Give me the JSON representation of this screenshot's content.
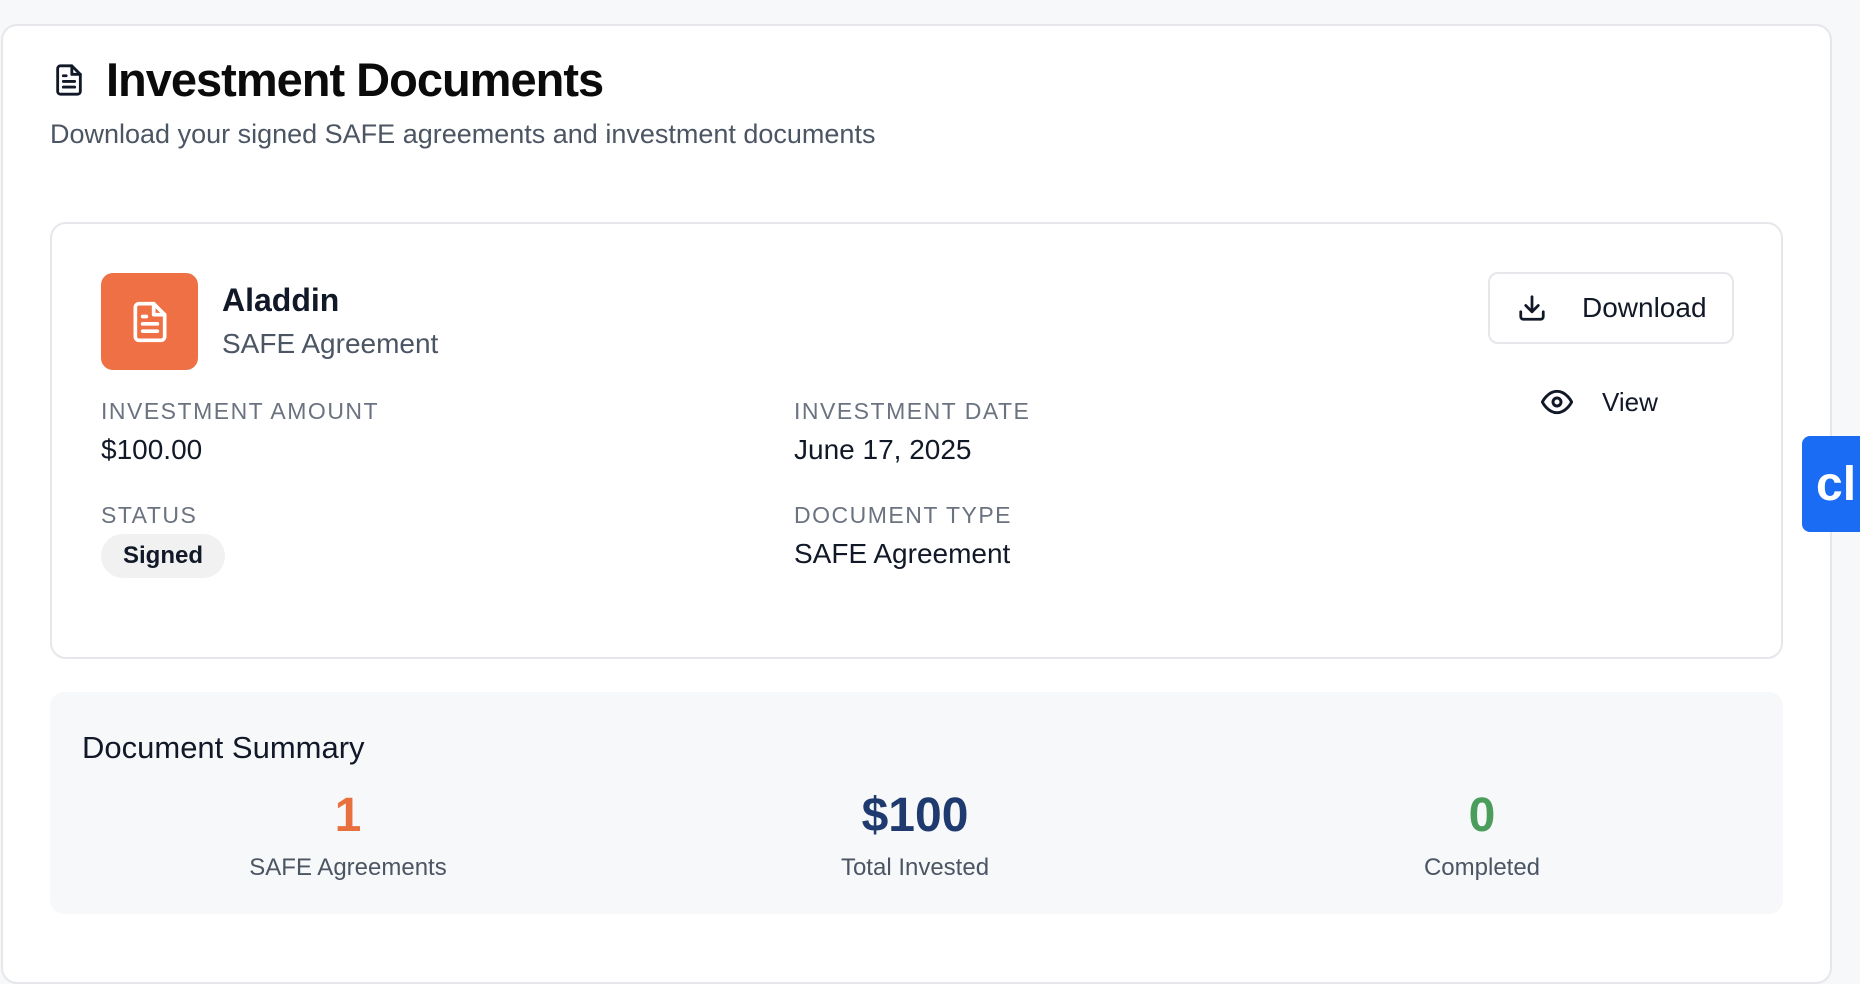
{
  "header": {
    "title": "Investment Documents",
    "subtitle": "Download your signed SAFE agreements and investment documents"
  },
  "document": {
    "name": "Aladdin",
    "type_sub": "SAFE Agreement",
    "fields": {
      "amount_label": "INVESTMENT AMOUNT",
      "amount_value": "$100.00",
      "date_label": "INVESTMENT DATE",
      "date_value": "June 17, 2025",
      "status_label": "STATUS",
      "status_value": "Signed",
      "doctype_label": "DOCUMENT TYPE",
      "doctype_value": "SAFE Agreement"
    },
    "actions": {
      "download_label": "Download",
      "view_label": "View"
    }
  },
  "summary": {
    "title": "Document Summary",
    "stats": [
      {
        "value": "1",
        "caption": "SAFE Agreements",
        "color": "#e8703f"
      },
      {
        "value": "$100",
        "caption": "Total Invested",
        "color": "#1e3a6e"
      },
      {
        "value": "0",
        "caption": "Completed",
        "color": "#4a9d5b"
      }
    ]
  },
  "side_tab": {
    "label": "cl"
  },
  "colors": {
    "accent_orange": "#ee7044",
    "side_tab_blue": "#1a6cf5"
  }
}
